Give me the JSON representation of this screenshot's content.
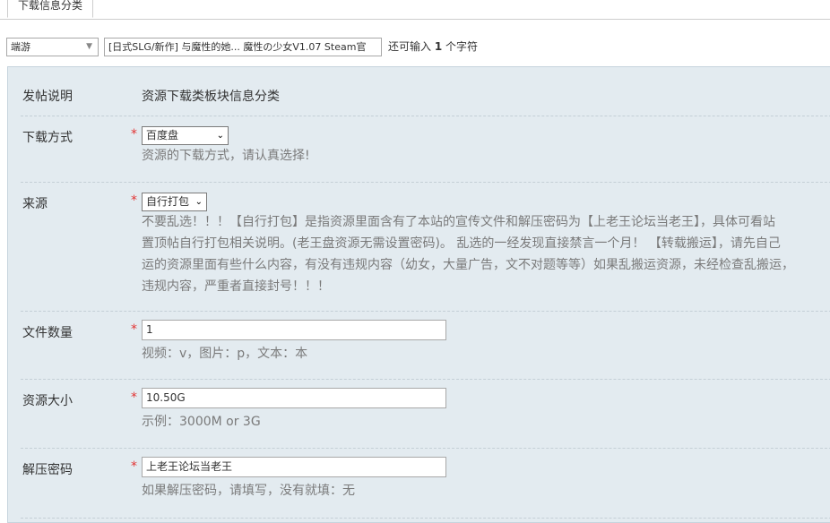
{
  "tab": {
    "label": "下载信息分类"
  },
  "subject": {
    "type_value": "端游",
    "title_value": "[日式SLG/新作] 与魔性的她... 魔性の少女V1.07 Steam官",
    "hint_prefix": "还可输入",
    "hint_count": "1",
    "hint_suffix": "个字符"
  },
  "form": {
    "intro": {
      "label": "发帖说明",
      "value": "资源下载类板块信息分类"
    },
    "download_method": {
      "label": "下载方式",
      "value": "百度盘",
      "desc": "资源的下载方式，请认真选择!"
    },
    "source": {
      "label": "来源",
      "value": "自行打包",
      "desc_lines": [
        "不要乱选！！！【自行打包】是指资源里面含有了本站的宣传文件和解压密码为【上老王论坛当老王】，具体可看站",
        "置顶帖自行打包相关说明。(老王盘资源无需设置密码)。 乱选的一经发现直接禁言一个月！ 【转载搬运】，请先自己",
        "运的资源里面有些什么内容，有没有违规内容（幼女，大量广告，文不对题等等）如果乱搬运资源，未经检查乱搬运，",
        "违规内容，严重者直接封号！！！"
      ]
    },
    "file_count": {
      "label": "文件数量",
      "value": "1",
      "desc": "视频：v，图片：p，文本：本"
    },
    "size": {
      "label": "资源大小",
      "value": "10.50G",
      "desc": "示例：3000M or 3G"
    },
    "password": {
      "label": "解压密码",
      "value": "上老王论坛当老王",
      "desc": "如果解压密码，请填写，没有就填：无"
    },
    "required_mark": "*"
  }
}
